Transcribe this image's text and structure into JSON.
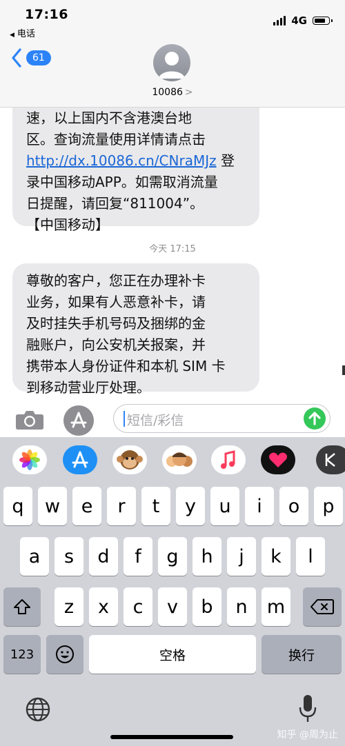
{
  "status_bar": {
    "time": "17:16",
    "back_app": "电话",
    "network": "4G",
    "battery_percent": 80
  },
  "header": {
    "unread_count": "61",
    "contact_name": "10086",
    "chevron": ">"
  },
  "conversation": {
    "message1": {
      "lines": [
        "速，以上国内不含港澳台地",
        "区。查询流量使用详情请点击"
      ],
      "link": "http://dx.10086.cn/CNraMJz",
      "after_link": " 登",
      "tail_lines": [
        "录中国移动APP。如需取消流量",
        "日提醒，请回复“811004”。",
        "【中国移动】"
      ]
    },
    "timestamp": "今天 17:15",
    "message2": {
      "lines": [
        "尊敬的客户，您正在办理补卡",
        "业务，如果有人恶意补卡，请",
        "及时挂失手机号码及捆绑的金",
        "融账户，向公安机关报案，并",
        "携带本人身份证件和本机 SIM 卡",
        "到移动营业厅处理。"
      ]
    }
  },
  "input_bar": {
    "placeholder": "短信/彩信"
  },
  "app_strip": [
    {
      "name": "photos-app-icon"
    },
    {
      "name": "appstore-app-icon"
    },
    {
      "name": "animoji-monkey-icon"
    },
    {
      "name": "memoji-stickers-icon"
    },
    {
      "name": "music-app-icon"
    },
    {
      "name": "digital-touch-icon"
    },
    {
      "name": "k-app-icon"
    }
  ],
  "keyboard": {
    "row1": [
      "q",
      "w",
      "e",
      "r",
      "t",
      "y",
      "u",
      "i",
      "o",
      "p"
    ],
    "row2": [
      "a",
      "s",
      "d",
      "f",
      "g",
      "h",
      "j",
      "k",
      "l"
    ],
    "row3": [
      "z",
      "x",
      "c",
      "v",
      "b",
      "n",
      "m"
    ],
    "numbers_key": "123",
    "space_key": "空格",
    "return_key": "换行"
  },
  "watermark": "知乎 @周为止",
  "colors": {
    "link": "#1a66d6",
    "accent": "#2c83f7",
    "send": "#34c759",
    "bubble": "#e9e9eb"
  }
}
